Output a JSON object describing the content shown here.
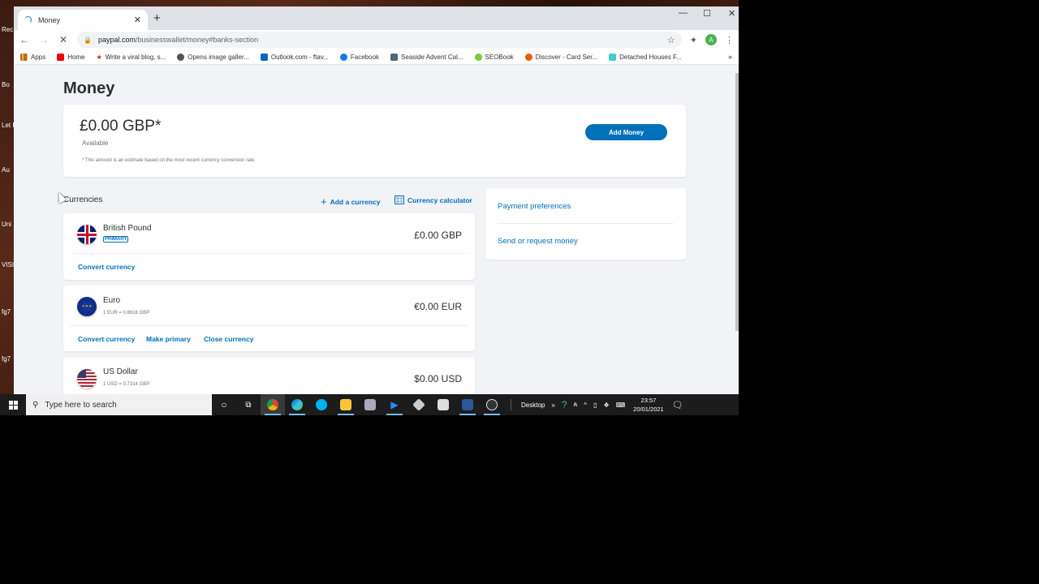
{
  "desktop": {
    "icons": [
      "Rec",
      "Bo",
      "Let Ema",
      "Au",
      "Uni",
      "VISI",
      "fg7",
      "fg7"
    ]
  },
  "browser": {
    "tab": {
      "title": "Money"
    },
    "url": {
      "domain": "paypal.com",
      "path": "/businesswallet/money#banks-section"
    },
    "profile_initial": "A",
    "bookmarks": [
      {
        "label": "Apps",
        "icon": "apps-grid-icon",
        "color": "#e44"
      },
      {
        "label": "Home",
        "icon": "youtube-icon",
        "color": "#e00"
      },
      {
        "label": "Write a viral blog, s...",
        "icon": "star-icon",
        "color": "#b22"
      },
      {
        "label": "Opens image galler...",
        "icon": "globe-icon",
        "color": "#555"
      },
      {
        "label": "Outlook.com - ftav...",
        "icon": "outlook-icon",
        "color": "#0a64c2"
      },
      {
        "label": "Facebook",
        "icon": "facebook-icon",
        "color": "#1877f2"
      },
      {
        "label": "Seaside Advent Cal...",
        "icon": "image-icon",
        "color": "#4a6a7a"
      },
      {
        "label": "SEOBook",
        "icon": "seobook-icon",
        "color": "#7c3"
      },
      {
        "label": "Discover - Card Ser...",
        "icon": "discover-icon",
        "color": "#e65c00"
      },
      {
        "label": "Detached Houses F...",
        "icon": "house-icon",
        "color": "#4cc"
      }
    ],
    "bookmarks_more": "»"
  },
  "page": {
    "title": "Money",
    "balance": {
      "amount": "£0.00 GBP*",
      "label": "Available",
      "note": "* This amount is an estimate based on the most recent currency conversion rate.",
      "add_money": "Add Money"
    },
    "currencies": {
      "header": "Currencies",
      "add_currency": "Add a currency",
      "calculator": "Currency calculator",
      "items": [
        {
          "name": "British Pound",
          "badge": "PRIMARY",
          "amount": "£0.00 GBP",
          "links": [
            "Convert currency"
          ]
        },
        {
          "name": "Euro",
          "rate": "1 EUR = 0.8616 GBP",
          "amount": "€0.00 EUR",
          "links": [
            "Convert currency",
            "Make primary",
            "Close currency"
          ]
        },
        {
          "name": "US Dollar",
          "rate": "1 USD = 0.7314 GBP",
          "amount": "$0.00 USD"
        }
      ]
    },
    "side_links": [
      "Payment preferences",
      "Send or request money"
    ]
  },
  "taskbar": {
    "search_placeholder": "Type here to search",
    "desktop_label": "Desktop",
    "time": "23:57",
    "date": "20/01/2021"
  },
  "colors": {
    "accent": "#0070ba"
  }
}
